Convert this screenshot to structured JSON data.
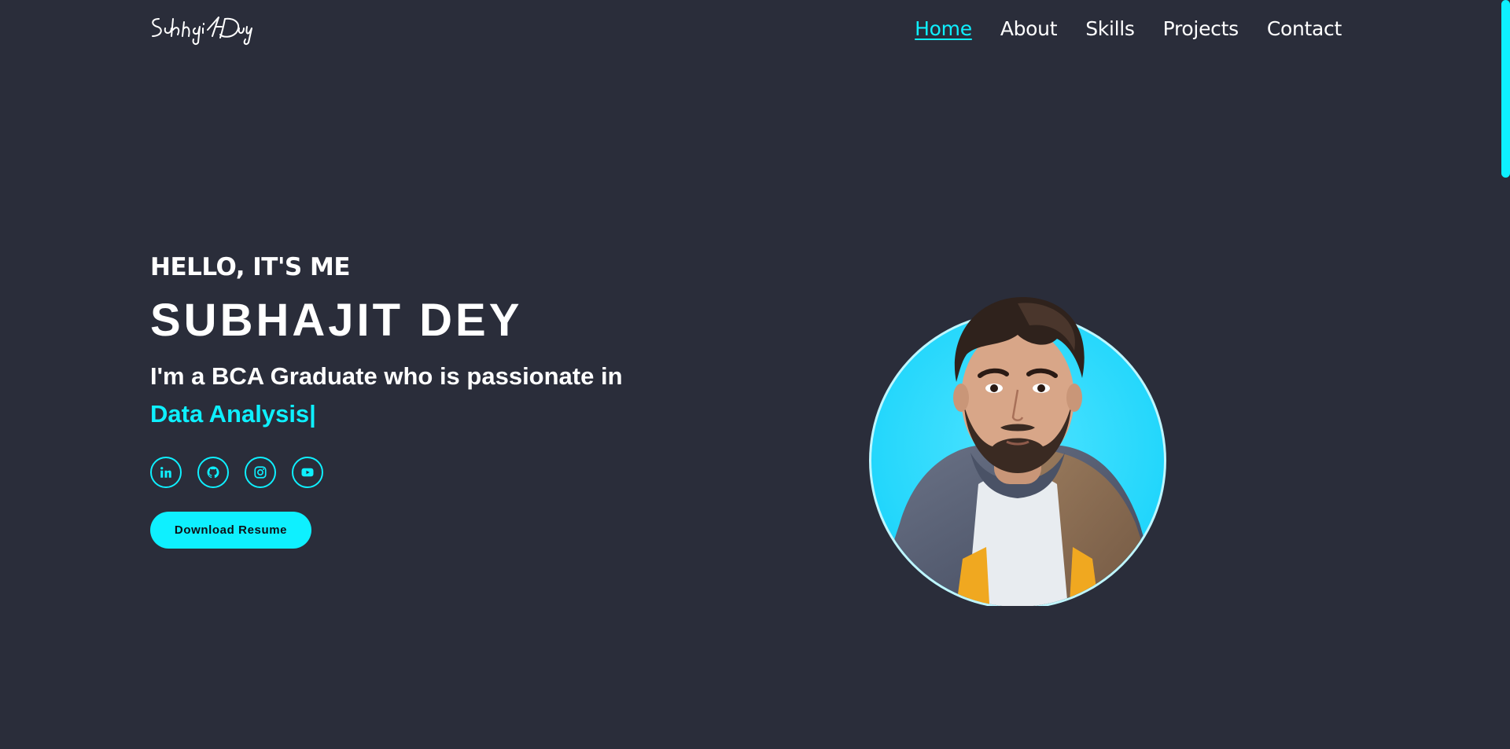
{
  "header": {
    "logo_signature": "Subhajit Dey",
    "nav": [
      {
        "label": "Home",
        "active": true
      },
      {
        "label": "About",
        "active": false
      },
      {
        "label": "Skills",
        "active": false
      },
      {
        "label": "Projects",
        "active": false
      },
      {
        "label": "Contact",
        "active": false
      }
    ]
  },
  "hero": {
    "greeting": "HELLO, IT'S ME",
    "name": "SUBHAJIT DEY",
    "tagline_prefix": "I'm a BCA Graduate who is passionate in",
    "tagline_highlight": "Data Analysis",
    "cursor": "|",
    "socials": [
      {
        "icon": "linkedin-icon"
      },
      {
        "icon": "github-icon"
      },
      {
        "icon": "instagram-icon"
      },
      {
        "icon": "youtube-icon"
      }
    ],
    "button_label": "Download Resume"
  },
  "colors": {
    "background": "#2a2d3a",
    "accent": "#0ef0ff",
    "text": "#ffffff"
  }
}
